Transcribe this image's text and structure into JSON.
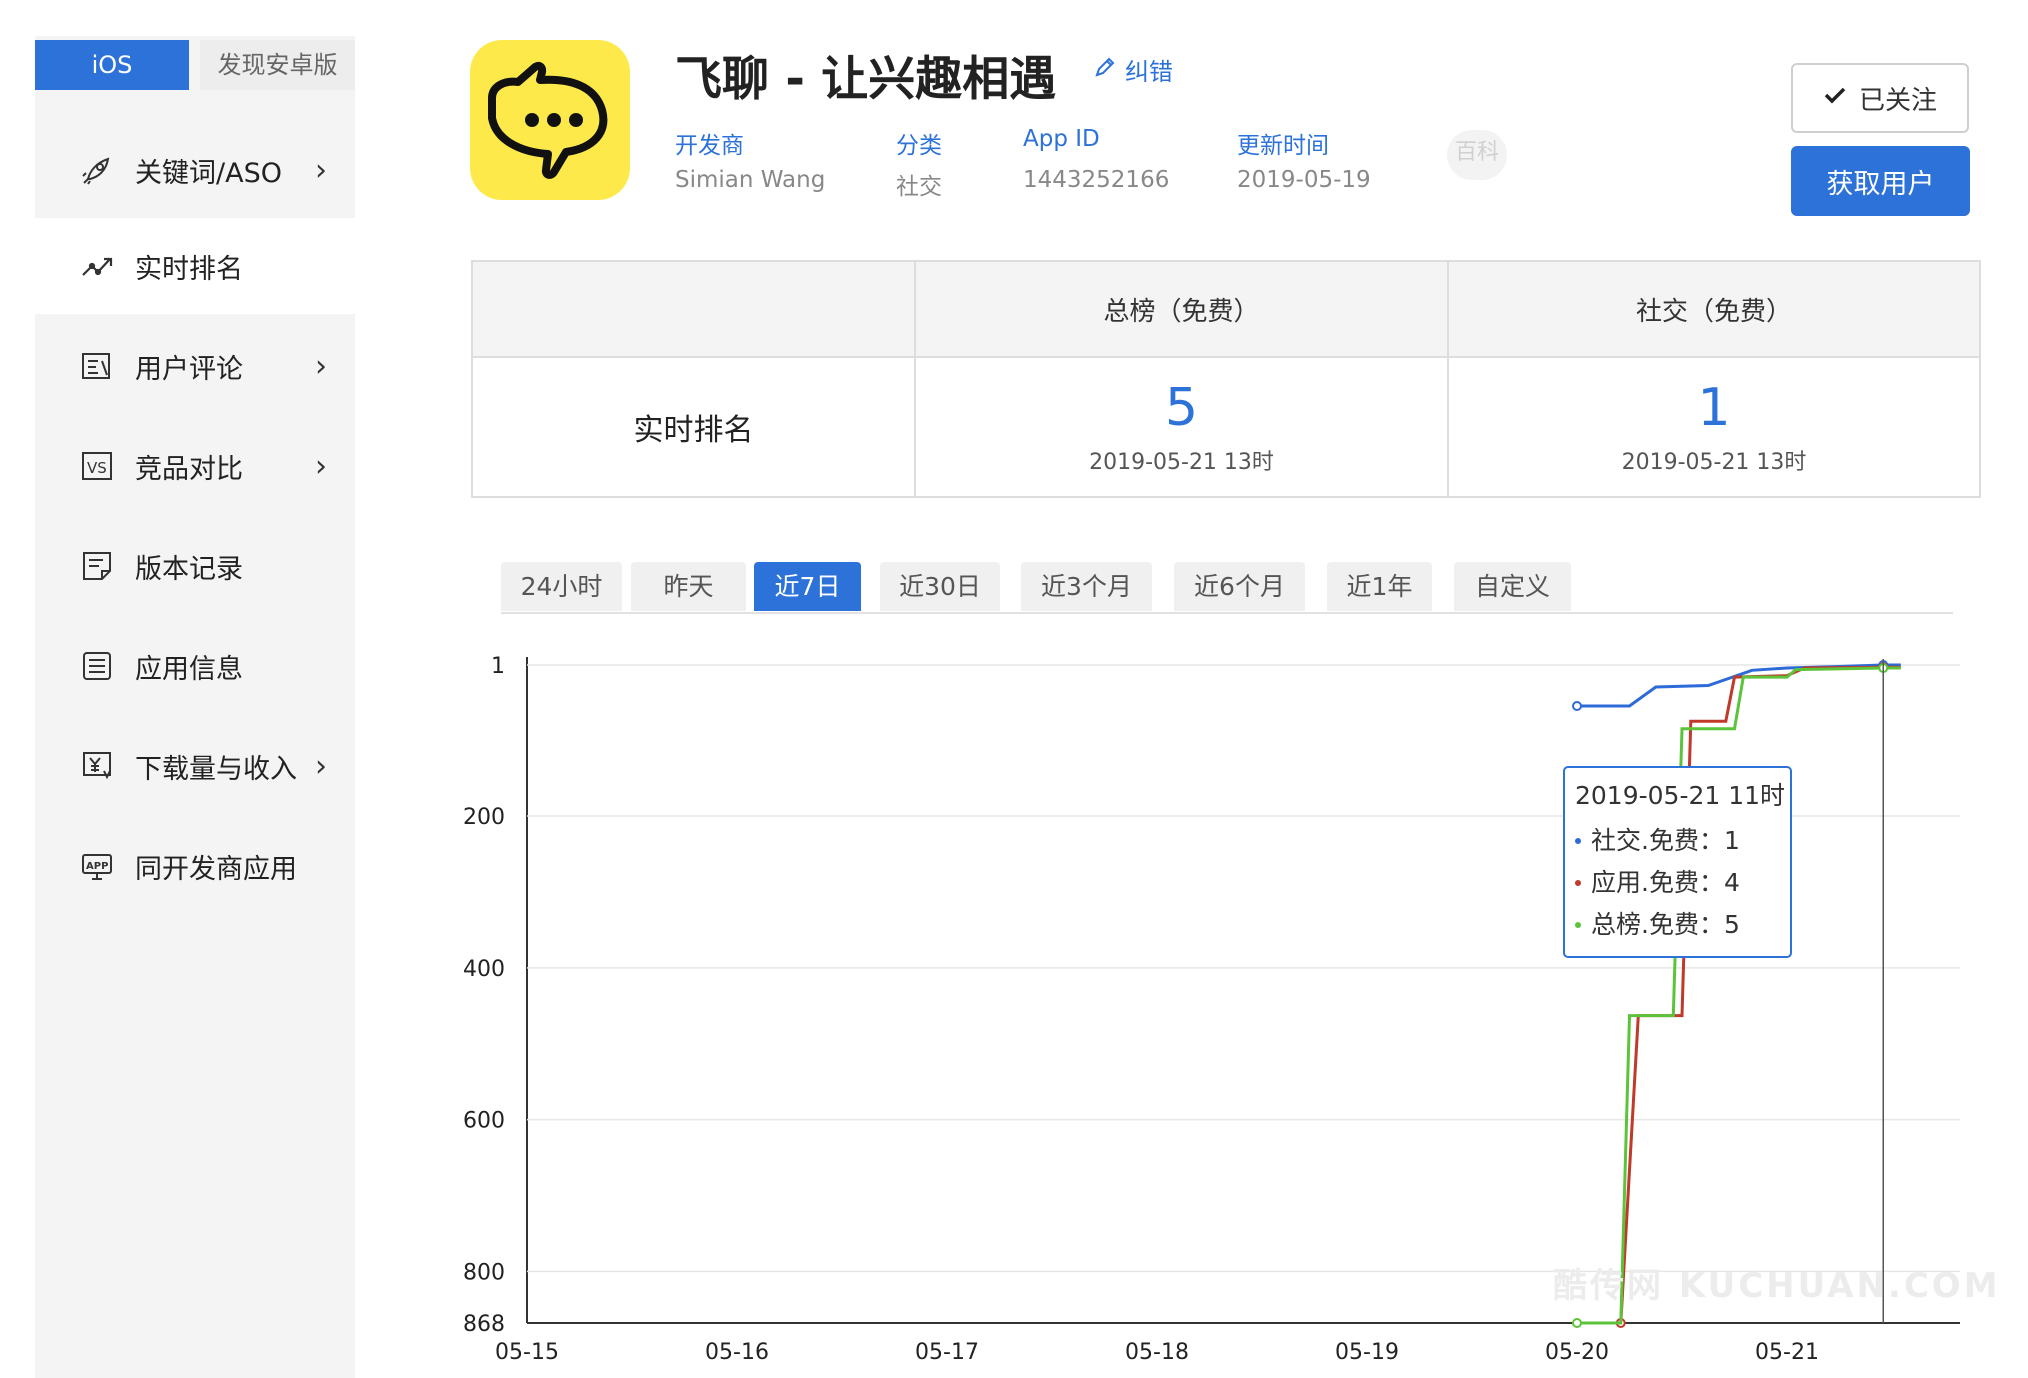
{
  "sidebar": {
    "os_tabs": {
      "ios": "iOS",
      "android": "发现安卓版"
    },
    "items": [
      {
        "label": "关键词/ASO",
        "icon": "rocket-icon",
        "chevron": "›"
      },
      {
        "label": "实时排名",
        "icon": "trend-line-icon",
        "chevron": ""
      },
      {
        "label": "用户评论",
        "icon": "comment-doc-icon",
        "chevron": "›"
      },
      {
        "label": "竞品对比",
        "icon": "vs-icon",
        "chevron": "›"
      },
      {
        "label": "版本记录",
        "icon": "version-doc-icon",
        "chevron": ""
      },
      {
        "label": "应用信息",
        "icon": "info-doc-icon",
        "chevron": ""
      },
      {
        "label": "下载量与收入",
        "icon": "yen-icon",
        "chevron": "›"
      },
      {
        "label": "同开发商应用",
        "icon": "app-icon",
        "chevron": ""
      }
    ]
  },
  "app": {
    "title": "飞聊 - 让兴趣相遇",
    "edit_label": "纠错",
    "meta": [
      {
        "label": "开发商",
        "value": "Simian Wang"
      },
      {
        "label": "分类",
        "value": "社交"
      },
      {
        "label": "App ID",
        "value": "1443252166"
      },
      {
        "label": "更新时间",
        "value": "2019-05-19"
      }
    ],
    "baike": "百科"
  },
  "actions": {
    "follow": "已关注",
    "acquire": "获取用户"
  },
  "rank_table": {
    "row_label": "实时排名",
    "columns": [
      {
        "header": "总榜（免费）",
        "rank": "5",
        "time": "2019-05-21 13时"
      },
      {
        "header": "社交（免费）",
        "rank": "1",
        "time": "2019-05-21 13时"
      }
    ]
  },
  "period_tabs": [
    "24小时",
    "昨天",
    "近7日",
    "近30日",
    "近3个月",
    "近6个月",
    "近1年",
    "自定义"
  ],
  "active_tab": "近7日",
  "tooltip": {
    "title": "2019-05-21 11时",
    "rows": [
      {
        "label": "社交.免费：",
        "value": "1",
        "color": "#2d6bd9"
      },
      {
        "label": "应用.免费：",
        "value": "4",
        "color": "#c0392b"
      },
      {
        "label": "总榜.免费：",
        "value": "5",
        "color": "#5cc43a"
      }
    ]
  },
  "watermark": "酷传网 KUCHUAN.COM",
  "chart_data": {
    "type": "line",
    "x_ticks": [
      "05-15",
      "05-16",
      "05-17",
      "05-18",
      "05-19",
      "05-20",
      "05-21"
    ],
    "y_ticks": [
      1,
      200,
      400,
      600,
      800,
      868
    ],
    "y_inverted": true,
    "ylim": [
      1,
      868
    ],
    "grid": true,
    "series": [
      {
        "name": "社交.免费",
        "color": "#2d6bd9",
        "points": [
          [
            "05-20 00",
            55
          ],
          [
            "05-20 06",
            55
          ],
          [
            "05-20 09",
            30
          ],
          [
            "05-20 15",
            28
          ],
          [
            "05-20 20",
            8
          ],
          [
            "05-21 00",
            5
          ],
          [
            "05-21 06",
            3
          ],
          [
            "05-21 11",
            1
          ],
          [
            "05-21 13",
            1
          ]
        ]
      },
      {
        "name": "应用.免费",
        "color": "#c0392b",
        "points": [
          [
            "05-20 05",
            868
          ],
          [
            "05-20 07",
            463
          ],
          [
            "05-20 12",
            463
          ],
          [
            "05-20 13",
            75
          ],
          [
            "05-20 17",
            75
          ],
          [
            "05-20 18",
            17
          ],
          [
            "05-21 00",
            15
          ],
          [
            "05-21 02",
            5
          ],
          [
            "05-21 11",
            4
          ],
          [
            "05-21 13",
            4
          ]
        ]
      },
      {
        "name": "总榜.免费",
        "color": "#5cc43a",
        "points": [
          [
            "05-20 00",
            868
          ],
          [
            "05-20 05",
            868
          ],
          [
            "05-20 06",
            463
          ],
          [
            "05-20 11",
            463
          ],
          [
            "05-20 12",
            85
          ],
          [
            "05-20 18",
            85
          ],
          [
            "05-20 19",
            17
          ],
          [
            "05-21 00",
            17
          ],
          [
            "05-21 01",
            7
          ],
          [
            "05-21 11",
            5
          ],
          [
            "05-21 13",
            5
          ]
        ]
      }
    ],
    "crosshair_x": "05-21 11"
  }
}
